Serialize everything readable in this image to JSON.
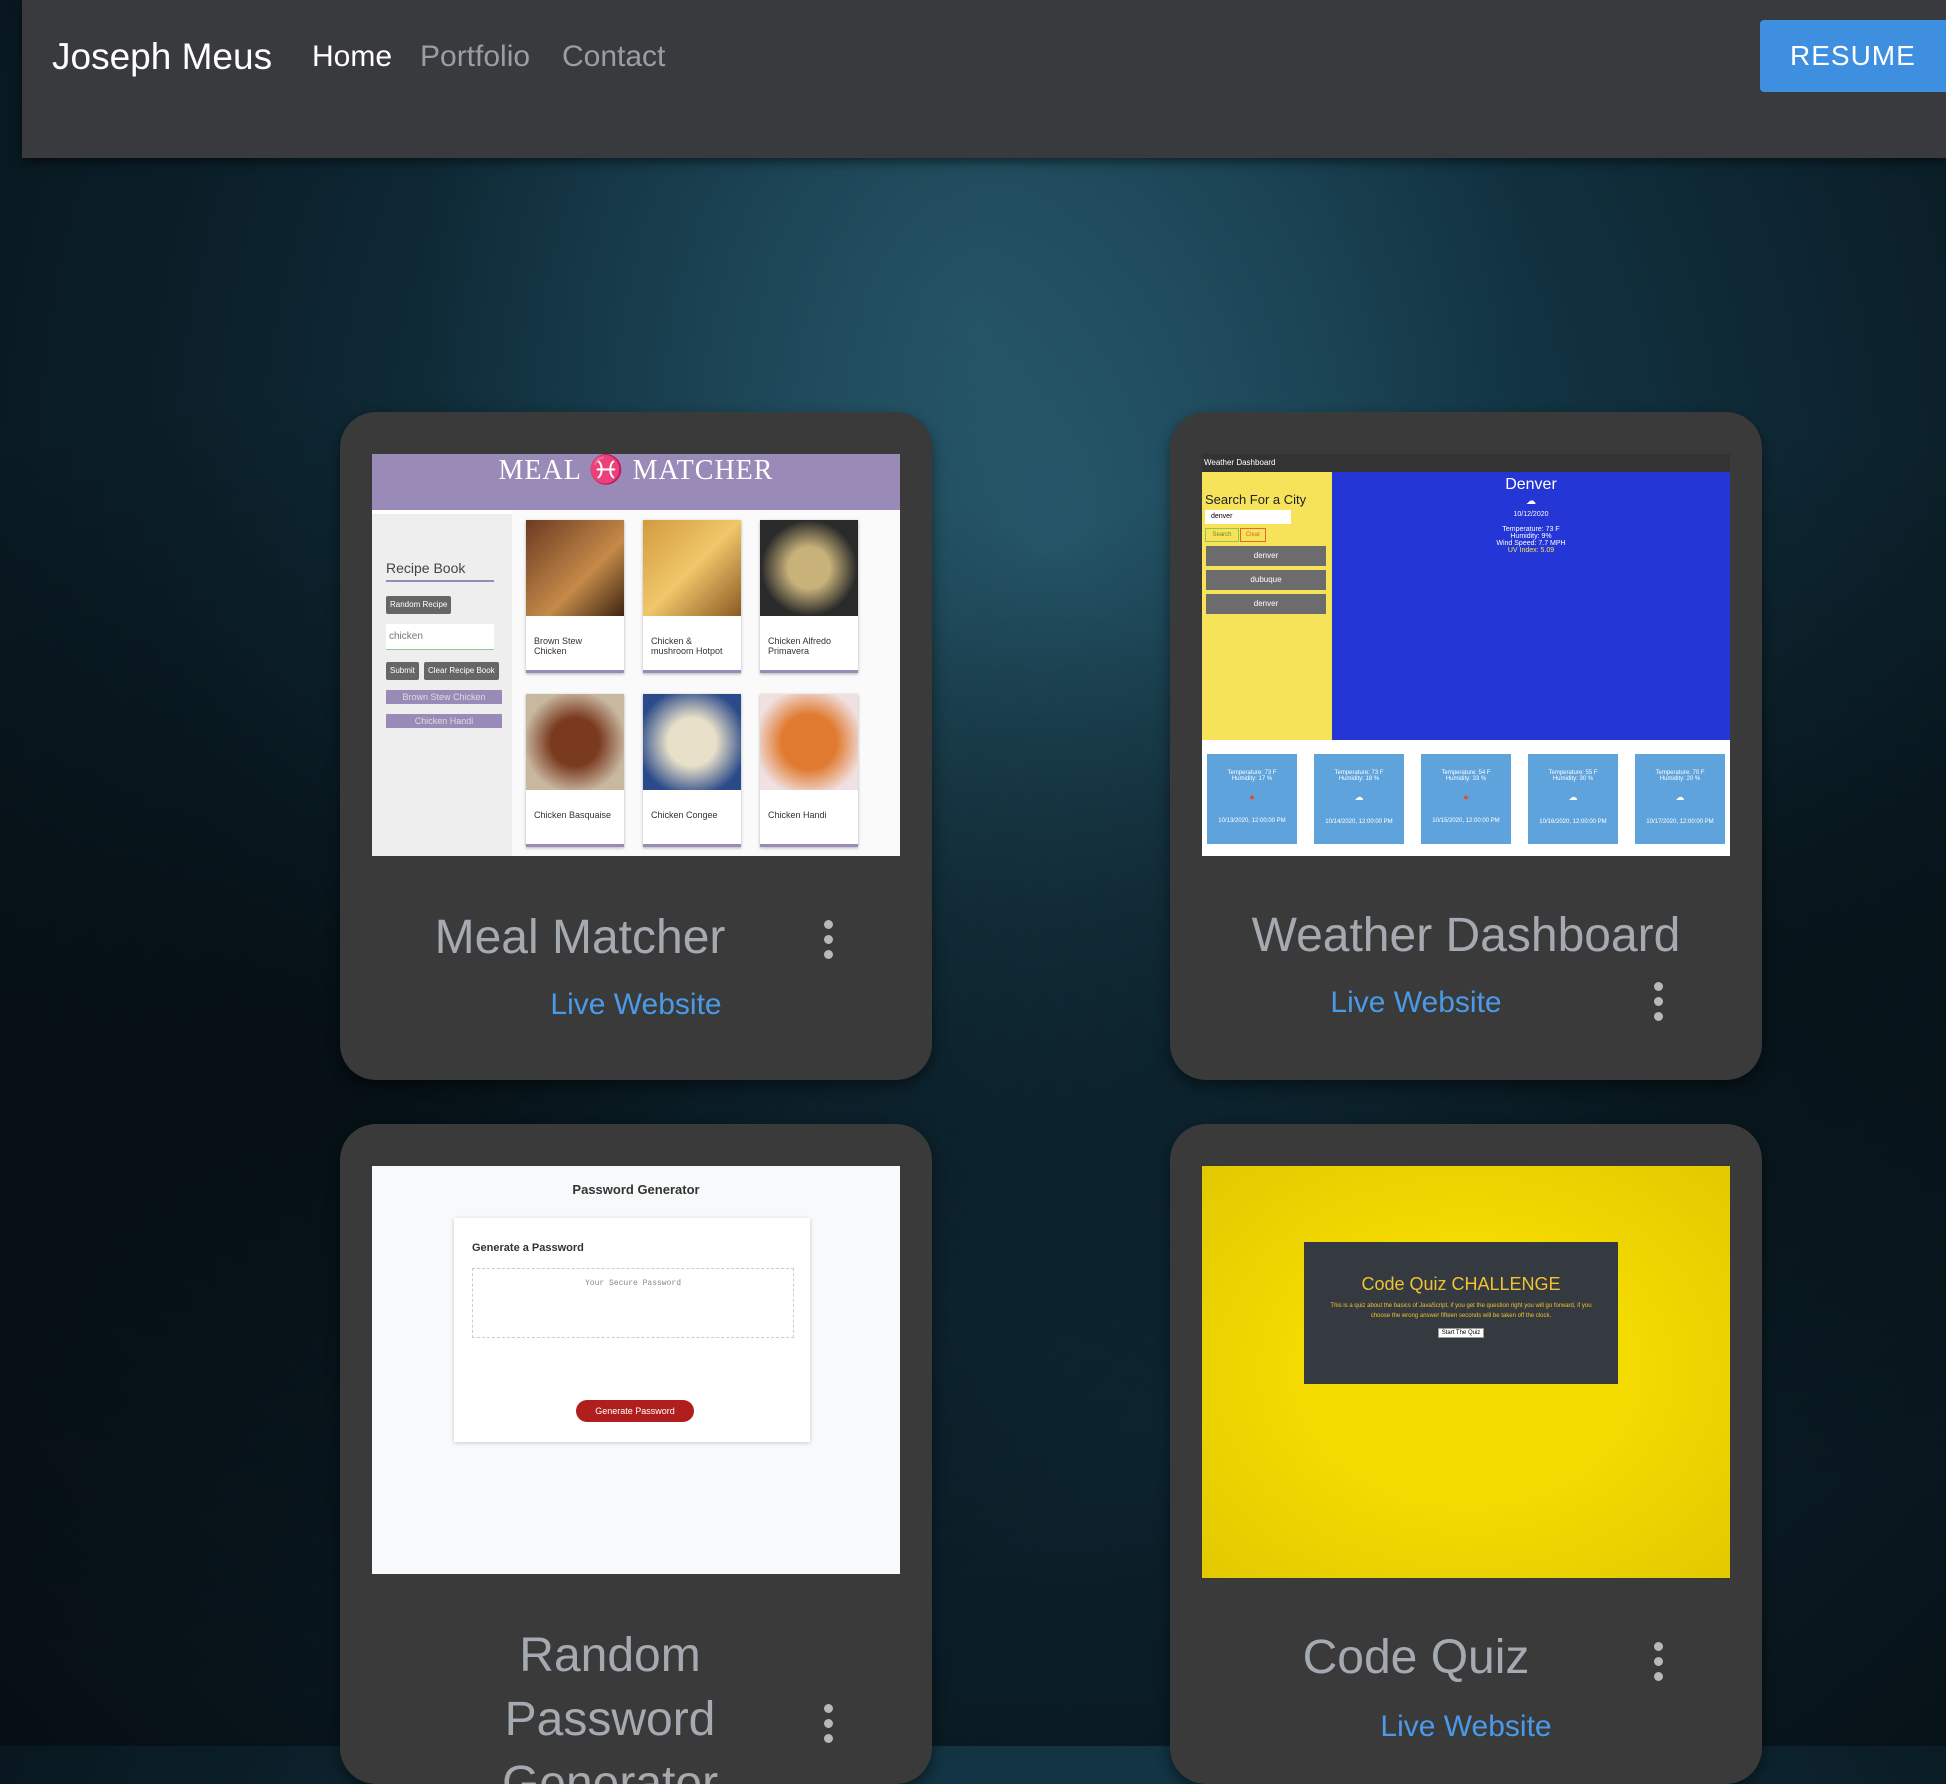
{
  "nav": {
    "brand": "Joseph Meus",
    "links": [
      "Home",
      "Portfolio",
      "Contact"
    ],
    "resume_label": "RESUME"
  },
  "projects": [
    {
      "title": "Meal Matcher",
      "link_label": "Live Website",
      "screenshot": {
        "header": "MEAL ♓ MATCHER",
        "sidebar_title": "Recipe Book",
        "random_button": "Random Recipe",
        "search_value": "chicken",
        "submit_button": "Submit",
        "clear_button": "Clear Recipe Book",
        "saved": [
          "Brown Stew Chicken",
          "Chicken Handi"
        ],
        "recipes": [
          "Brown Stew Chicken",
          "Chicken & mushroom Hotpot",
          "Chicken Alfredo Primavera",
          "Chicken Basquaise",
          "Chicken Congee",
          "Chicken Handi"
        ]
      }
    },
    {
      "title": "Weather Dashboard",
      "link_label": "Live Website",
      "screenshot": {
        "app_title": "Weather Dashboard",
        "search_label": "Search For a City",
        "search_value": "denver",
        "search_button": "Search",
        "clear_button": "Clear",
        "history": [
          "denver",
          "dubuque",
          "denver"
        ],
        "city": "Denver",
        "date": "10/12/2020",
        "temperature": "Temperature: 73 F",
        "humidity": "Humidity: 9%",
        "wind": "Wind Speed: 7.7 MPH",
        "uv": "UV Index: 5.09",
        "forecast": [
          {
            "temp": "Temperature: 73 F",
            "hum": "Humidity: 17 %",
            "date": "10/13/2020, 12:00:00 PM"
          },
          {
            "temp": "Temperature: 73 F",
            "hum": "Humidity: 18 %",
            "date": "10/14/2020, 12:00:00 PM"
          },
          {
            "temp": "Temperature: 54 F",
            "hum": "Humidity: 33 %",
            "date": "10/15/2020, 12:00:00 PM"
          },
          {
            "temp": "Temperature: 55 F",
            "hum": "Humidity: 30 %",
            "date": "10/16/2020, 12:00:00 PM"
          },
          {
            "temp": "Temperature: 70 F",
            "hum": "Humidity: 20 %",
            "date": "10/17/2020, 12:00:00 PM"
          }
        ]
      }
    },
    {
      "title": "Random Password Generator",
      "title_lines": [
        "Random Password",
        "Generator"
      ],
      "screenshot": {
        "app_title": "Password Generator",
        "box_title": "Generate a Password",
        "placeholder": "Your Secure Password",
        "button": "Generate Password"
      }
    },
    {
      "title": "Code Quiz",
      "link_label": "Live Website",
      "screenshot": {
        "heading": "Code Quiz CHALLENGE",
        "description": "This is a quiz about the basics of JavaScript, if you get the question right you will go forward, if you choose the wrong answer fifteen seconds will be taken off the clock.",
        "button": "Start The Quiz"
      }
    }
  ],
  "colors": {
    "navbar": "#383a3d",
    "card": "#3a3a3a",
    "accent": "#3f8fe0",
    "link": "#4a9ae8"
  },
  "icons": {
    "card_menu": "more-vert-icon"
  }
}
